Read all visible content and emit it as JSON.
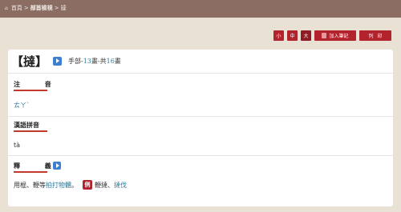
{
  "breadcrumb": {
    "home": "首頁",
    "sep1": ">",
    "section": "部首檢視",
    "sep2": ">",
    "current": "撻"
  },
  "toolbar": {
    "size_small": "小",
    "size_medium": "中",
    "size_large": "大",
    "add_note": "加入筆記",
    "print": "列印"
  },
  "entry": {
    "headword": "【撻】",
    "radical_prefix": "手部-",
    "radical_strokes": "13",
    "mid_text": "畫-共",
    "total_strokes": "16",
    "suffix": "畫"
  },
  "sections": {
    "zhuyin_title": "注 音",
    "zhuyin_value": "ㄊㄚˋ",
    "pinyin_title": "漢語拼音",
    "pinyin_value": "tà",
    "meaning_title": "釋 義"
  },
  "definition": {
    "text": "用棍、鞭等",
    "link_text": "拍打物體",
    "end": "。",
    "example_badge": "例",
    "example_1": "鞭撻",
    "sep": "、",
    "example_2": "撻伐"
  }
}
